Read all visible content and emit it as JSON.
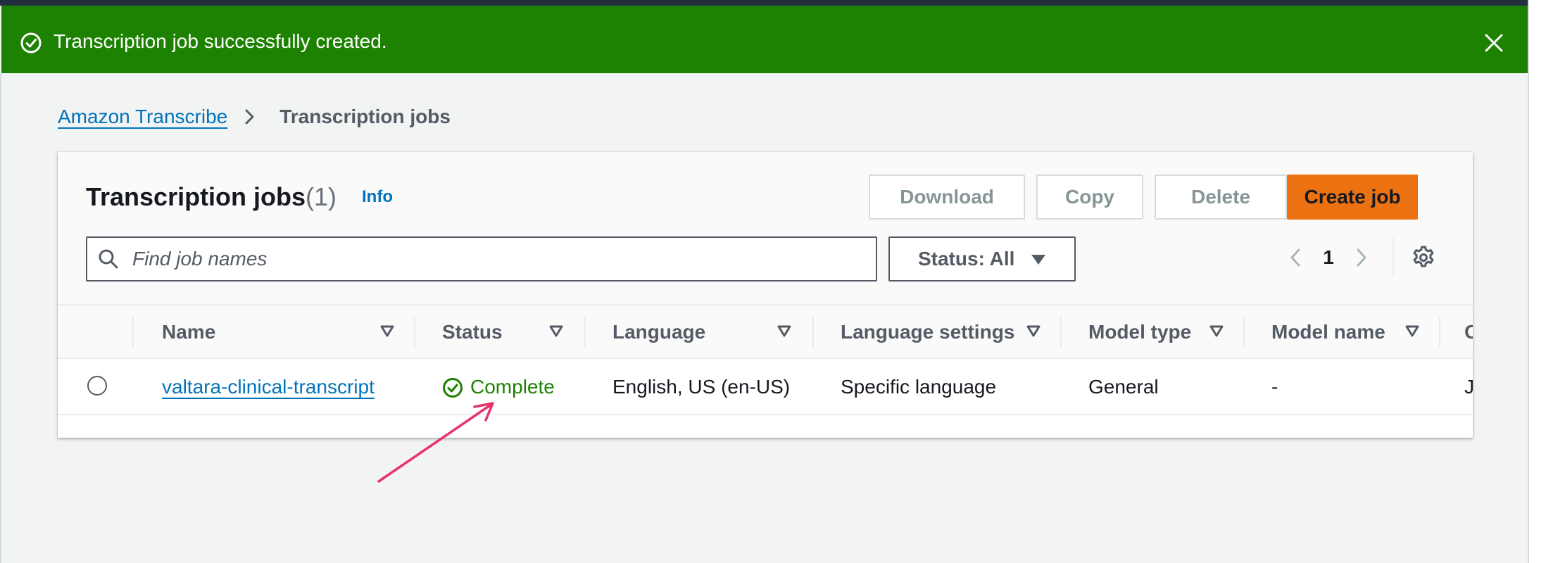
{
  "flashbar": {
    "message": "Transcription job successfully created.",
    "color": "#1d8102"
  },
  "breadcrumb": {
    "items": [
      {
        "label": "Amazon Transcribe"
      },
      {
        "label": "Transcription jobs"
      }
    ]
  },
  "panel": {
    "title": "Transcription jobs",
    "count": "(1)",
    "info_label": "Info",
    "actions": {
      "download": "Download",
      "copy": "Copy",
      "delete": "Delete",
      "create": "Create job"
    },
    "search": {
      "placeholder": "Find job names",
      "value": ""
    },
    "status_filter": {
      "selected": "Status: All"
    },
    "pagination": {
      "current_page": "1"
    }
  },
  "table": {
    "columns": [
      {
        "label": "Name"
      },
      {
        "label": "Status"
      },
      {
        "label": "Language"
      },
      {
        "label": "Language settings"
      },
      {
        "label": "Model type"
      },
      {
        "label": "Model name"
      },
      {
        "label": "C"
      }
    ],
    "rows": [
      {
        "name": "valtara-clinical-transcript",
        "status": "Complete",
        "language": "English, US (en-US)",
        "language_settings": "Specific language",
        "model_type": "General",
        "model_name": "-",
        "created": "J"
      }
    ]
  },
  "colors": {
    "accent_link": "#0073bb",
    "primary_button": "#ec7211",
    "success": "#1d8102",
    "annotation_arrow": "#e8336a"
  }
}
